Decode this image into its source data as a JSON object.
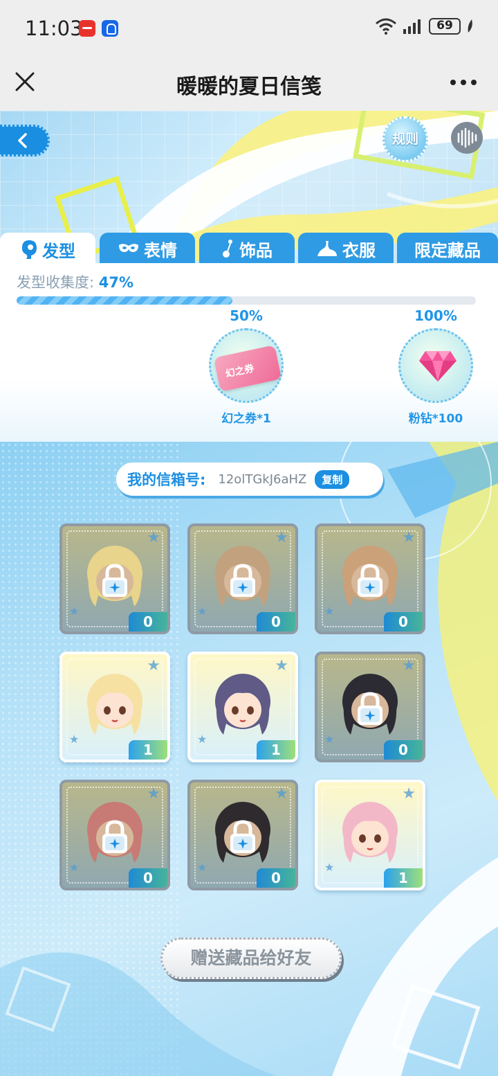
{
  "status_bar": {
    "time": "11:03",
    "battery": "69"
  },
  "title_bar": {
    "title": "暖暖的夏日信笺"
  },
  "hero": {
    "rules_label": "规则"
  },
  "tabs": [
    {
      "label": "发型",
      "icon": "hair-icon"
    },
    {
      "label": "表情",
      "icon": "mask-icon"
    },
    {
      "label": "饰品",
      "icon": "accessory-icon"
    },
    {
      "label": "衣服",
      "icon": "clothes-icon"
    },
    {
      "label": "限定藏品",
      "icon": ""
    }
  ],
  "progress": {
    "label": "发型收集度:",
    "value_text": "47%",
    "fraction": 0.47
  },
  "milestones": [
    {
      "pct": "50%",
      "reward": "幻之券*1",
      "item_text": "幻之券"
    },
    {
      "pct": "100%",
      "reward": "粉钻*100"
    }
  ],
  "mailbox": {
    "label": "我的信箱号:",
    "id": "12olTGkJ6aHZ",
    "copy_label": "复制"
  },
  "items": [
    {
      "count": "0",
      "owned": false,
      "hair": "#e8d48a"
    },
    {
      "count": "0",
      "owned": false,
      "hair": "#c2a27e"
    },
    {
      "count": "0",
      "owned": false,
      "hair": "#caa179"
    },
    {
      "count": "1",
      "owned": true,
      "hair": "#f6e1a3"
    },
    {
      "count": "1",
      "owned": true,
      "hair": "#5f5a86"
    },
    {
      "count": "0",
      "owned": false,
      "hair": "#2c2a33"
    },
    {
      "count": "0",
      "owned": false,
      "hair": "#c77b74"
    },
    {
      "count": "0",
      "owned": false,
      "hair": "#2f2a2e"
    },
    {
      "count": "1",
      "owned": true,
      "hair": "#f3b8c8"
    }
  ],
  "gift_button": {
    "label": "赠送藏品给好友"
  },
  "colors": {
    "accent": "#1b8fe2",
    "tab_bg": "#2f9be4",
    "locked_border": "#8f9aa4"
  }
}
